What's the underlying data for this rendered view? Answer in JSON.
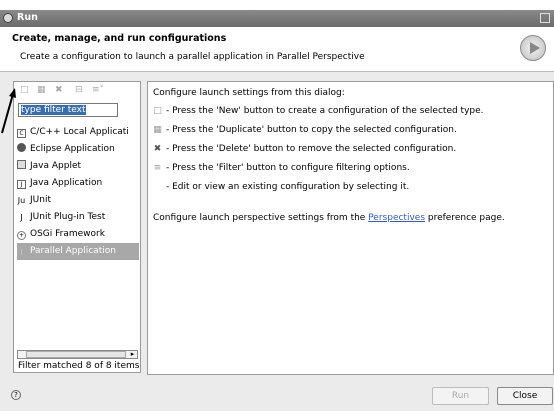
{
  "window": {
    "title": "Run"
  },
  "header": {
    "title": "Create, manage, and run configurations",
    "subtitle": "Create a configuration to launch a parallel application in Parallel Perspective"
  },
  "left": {
    "toolbar_icons": [
      "new-config-icon",
      "duplicate-icon",
      "delete-icon",
      "collapse-icon",
      "filter-icon"
    ],
    "filter_placeholder": "type filter text",
    "tree": [
      {
        "label": "C/C++ Local Applicati",
        "icon": "c-cpp-icon"
      },
      {
        "label": "Eclipse Application",
        "icon": "eclipse-icon"
      },
      {
        "label": "Java Applet",
        "icon": "java-applet-icon"
      },
      {
        "label": "Java Application",
        "icon": "java-app-icon"
      },
      {
        "label": "JUnit",
        "icon": "junit-icon"
      },
      {
        "label": "JUnit Plug-in Test",
        "icon": "junit-plugin-icon"
      },
      {
        "label": "OSGi Framework",
        "icon": "osgi-icon"
      },
      {
        "label": "Parallel Application",
        "icon": "parallel-icon",
        "selected": true
      }
    ],
    "status": "Filter matched 8 of 8 items"
  },
  "right": {
    "intro": "Configure launch settings from this dialog:",
    "lines": [
      "- Press the 'New' button to create a configuration of the selected type.",
      "- Press the 'Duplicate' button to copy the selected configuration.",
      "- Press the 'Delete' button to remove the selected configuration.",
      "- Press the 'Filter' button to configure filtering options.",
      "- Edit or view an existing configuration by selecting it."
    ],
    "perspective_prefix": "Configure launch perspective settings from the ",
    "perspective_link": "Perspectives",
    "perspective_suffix": " preference page."
  },
  "footer": {
    "run_label": "Run",
    "close_label": "Close"
  }
}
